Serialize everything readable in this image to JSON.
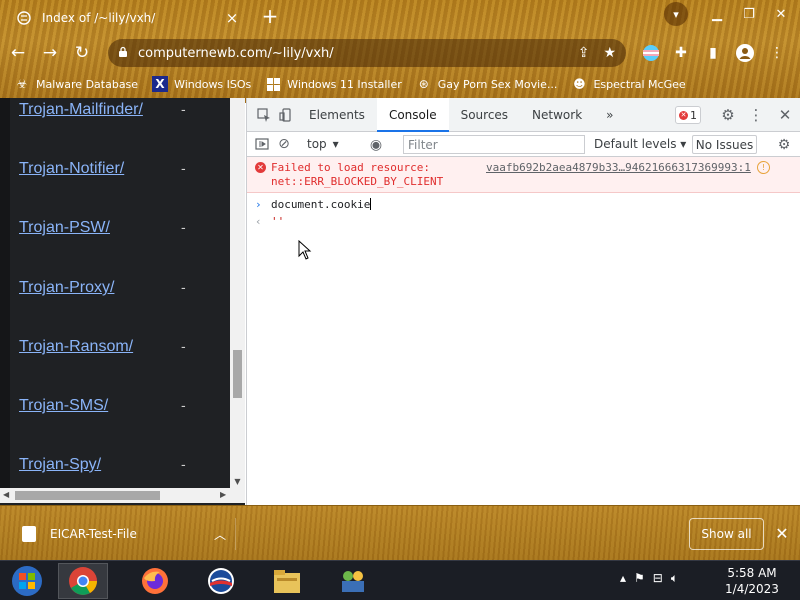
{
  "tab": {
    "title": "Index of /~lily/vxh/",
    "close": "×"
  },
  "url": "computernewb.com/~lily/vxh/",
  "bookmarks": [
    {
      "label": "Malware Database",
      "icon": "biohazard-icon"
    },
    {
      "label": "Windows ISOs",
      "icon": "x-logo-icon"
    },
    {
      "label": "Windows 11 Installer",
      "icon": "windows-logo-icon"
    },
    {
      "label": "Gay Porn Sex Movie...",
      "icon": "globe-icon"
    },
    {
      "label": "Espectral McGee",
      "icon": "avatar-icon"
    }
  ],
  "listing": [
    {
      "name": "Trojan-Mailfinder/",
      "size": "-"
    },
    {
      "name": "Trojan-Notifier/",
      "size": "-"
    },
    {
      "name": "Trojan-PSW/",
      "size": "-"
    },
    {
      "name": "Trojan-Proxy/",
      "size": "-"
    },
    {
      "name": "Trojan-Ransom/",
      "size": "-"
    },
    {
      "name": "Trojan-SMS/",
      "size": "-"
    },
    {
      "name": "Trojan-Spy/",
      "size": "-"
    }
  ],
  "devtools": {
    "tabs": [
      "Elements",
      "Console",
      "Sources",
      "Network"
    ],
    "active_tab": "Console",
    "more": "»",
    "error_count": "1",
    "context": "top",
    "filter_placeholder": "Filter",
    "levels": "Default levels",
    "no_issues": "No Issues",
    "error": {
      "line1": "Failed to load resource:",
      "line2": "net::ERR_BLOCKED_BY_CLIENT",
      "source": "vaafb692b2aea4879b33…94621666317369993:1"
    },
    "input": "document.cookie",
    "result": "''"
  },
  "download": {
    "name": "EICAR-Test-File",
    "show_all": "Show all"
  },
  "clock": {
    "time": "5:58 AM",
    "date": "1/4/2023"
  },
  "colors": {
    "link": "#8ab4f8",
    "accent": "#1a73e8",
    "error": "#e02d2d",
    "theme": "#b8821e"
  }
}
